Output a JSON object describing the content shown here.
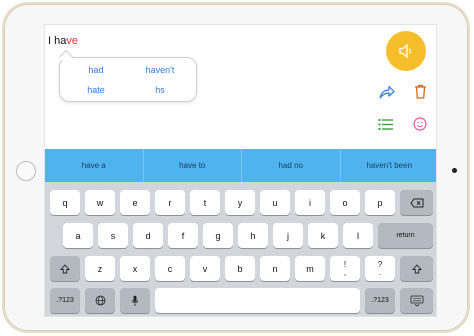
{
  "text_area": {
    "typed_prefix": "I ha",
    "typed_suffix": "ve"
  },
  "suggestions": [
    "had",
    "haven't",
    "hate",
    "hs"
  ],
  "predictions": [
    "have a",
    "have to",
    "had no",
    "haven't been"
  ],
  "keyboard": {
    "row1": [
      "q",
      "w",
      "e",
      "r",
      "t",
      "y",
      "u",
      "i",
      "o",
      "p"
    ],
    "row2": [
      "a",
      "s",
      "d",
      "f",
      "g",
      "h",
      "j",
      "k",
      "l"
    ],
    "row3": [
      "z",
      "x",
      "c",
      "v",
      "b",
      "n",
      "m"
    ],
    "return_label": "return",
    "numbers_label": ".?123",
    "comma_top": "!",
    "comma_bottom": ",",
    "period_top": "?",
    "period_bottom": ".",
    "numbers_label_right": ".?123"
  },
  "colors": {
    "speak_button": "#f4bf2a",
    "prediction_bar": "#4fb3ef",
    "suggestion_text": "#2f7bd3",
    "typed_fragment": "#e0343a"
  },
  "icons": [
    "speaker-icon",
    "share-arrow-icon",
    "trash-icon",
    "list-icon",
    "emoji-icon",
    "backspace-icon",
    "shift-icon",
    "globe-icon",
    "microphone-icon",
    "keyboard-dismiss-icon"
  ]
}
